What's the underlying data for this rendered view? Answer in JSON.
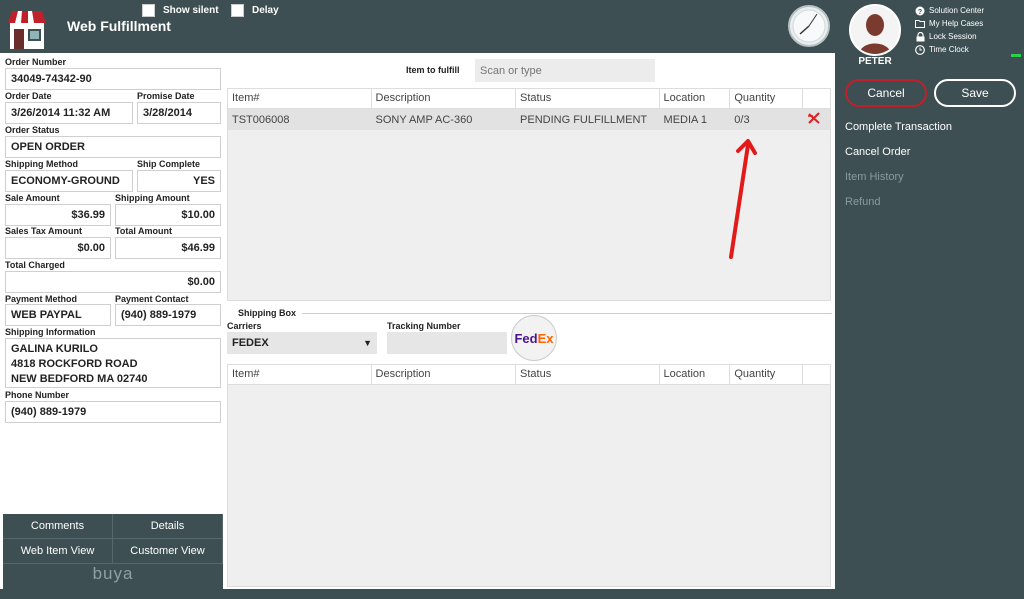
{
  "header": {
    "title": "Web Fulfillment",
    "show_silent_label": "Show silent",
    "delay_label": "Delay"
  },
  "order": {
    "order_number_label": "Order Number",
    "order_number": "34049-74342-90",
    "order_date_label": "Order Date",
    "order_date": "3/26/2014 11:32 AM",
    "promise_date_label": "Promise Date",
    "promise_date": "3/28/2014",
    "order_status_label": "Order Status",
    "order_status": "OPEN ORDER",
    "shipping_method_label": "Shipping Method",
    "shipping_method": "ECONOMY-GROUND",
    "ship_complete_label": "Ship Complete",
    "ship_complete": "YES",
    "sale_amount_label": "Sale Amount",
    "sale_amount": "$36.99",
    "shipping_amount_label": "Shipping Amount",
    "shipping_amount": "$10.00",
    "sales_tax_label": "Sales Tax Amount",
    "sales_tax": "$0.00",
    "total_amount_label": "Total Amount",
    "total_amount": "$46.99",
    "total_charged_label": "Total Charged",
    "total_charged": "$0.00",
    "payment_method_label": "Payment Method",
    "payment_method": "WEB PAYPAL",
    "payment_contact_label": "Payment Contact",
    "payment_contact": "(940) 889-1979",
    "shipping_info_label": "Shipping Information",
    "shipping_name": "GALINA KURILO",
    "shipping_street": "4818 ROCKFORD ROAD",
    "shipping_city": "NEW BEDFORD MA 02740",
    "phone_label": "Phone Number",
    "phone": "(940) 889-1979"
  },
  "left_buttons": {
    "comments": "Comments",
    "details": "Details",
    "web_item_view": "Web Item View",
    "customer_view": "Customer View",
    "brand": "buya"
  },
  "fulfill": {
    "label": "Item to fulfill",
    "placeholder": "Scan or type"
  },
  "items_table": {
    "headers": [
      "Item#",
      "Description",
      "Status",
      "Location",
      "Quantity"
    ],
    "rows": [
      {
        "item": "TST006008",
        "description": "SONY AMP AC-360",
        "status": "PENDING FULFILLMENT",
        "location": "MEDIA 1",
        "quantity": "0/3"
      }
    ]
  },
  "shipping_box": {
    "label": "Shipping Box",
    "carriers_label": "Carriers",
    "carrier": "FEDEX",
    "tracking_label": "Tracking Number",
    "tracking_value": "",
    "logo_fed": "Fed",
    "logo_ex": "Ex"
  },
  "box_table": {
    "headers": [
      "Item#",
      "Description",
      "Status",
      "Location",
      "Quantity"
    ]
  },
  "user": {
    "name": "PETER",
    "links": [
      "Solution Center",
      "My Help Cases",
      "Lock Session",
      "Time Clock"
    ]
  },
  "actions": {
    "cancel": "Cancel",
    "save": "Save",
    "items": [
      {
        "label": "Complete Transaction",
        "enabled": true
      },
      {
        "label": "Cancel Order",
        "enabled": true
      },
      {
        "label": "Item History",
        "enabled": false
      },
      {
        "label": "Refund",
        "enabled": false
      }
    ]
  },
  "colors": {
    "panel": "#3d4f52",
    "cancel_border": "#c0202a",
    "delete_red": "#e02020",
    "fedex_purple": "#4d148c",
    "fedex_orange": "#ff6200"
  }
}
